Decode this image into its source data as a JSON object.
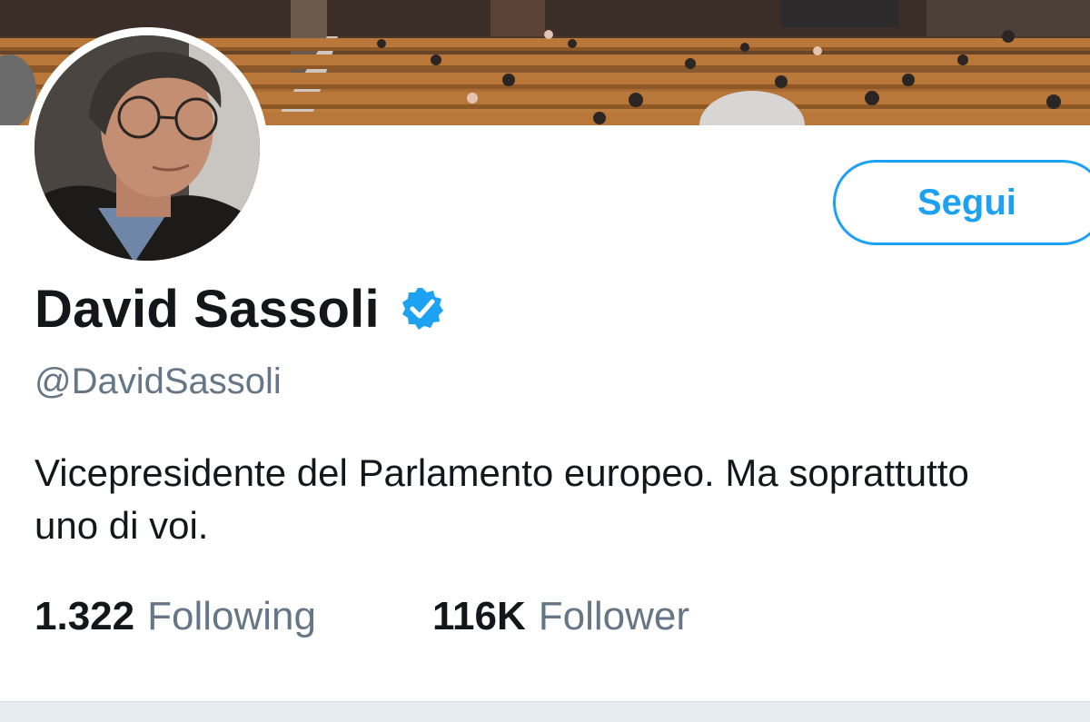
{
  "profile": {
    "display_name": "David Sassoli",
    "handle": "@DavidSassoli",
    "verified": true,
    "bio": "Vicepresidente del Parlamento europeo. Ma soprattutto uno di voi.",
    "follow_button_label": "Segui"
  },
  "stats": {
    "following_count": "1.322",
    "following_label": "Following",
    "followers_count": "116K",
    "followers_label": "Follower"
  },
  "colors": {
    "accent": "#1da1f2",
    "text_primary": "#14171a",
    "text_secondary": "#657786",
    "divider": "#e6ecf0"
  },
  "icons": {
    "verified": "verified-badge-icon"
  }
}
